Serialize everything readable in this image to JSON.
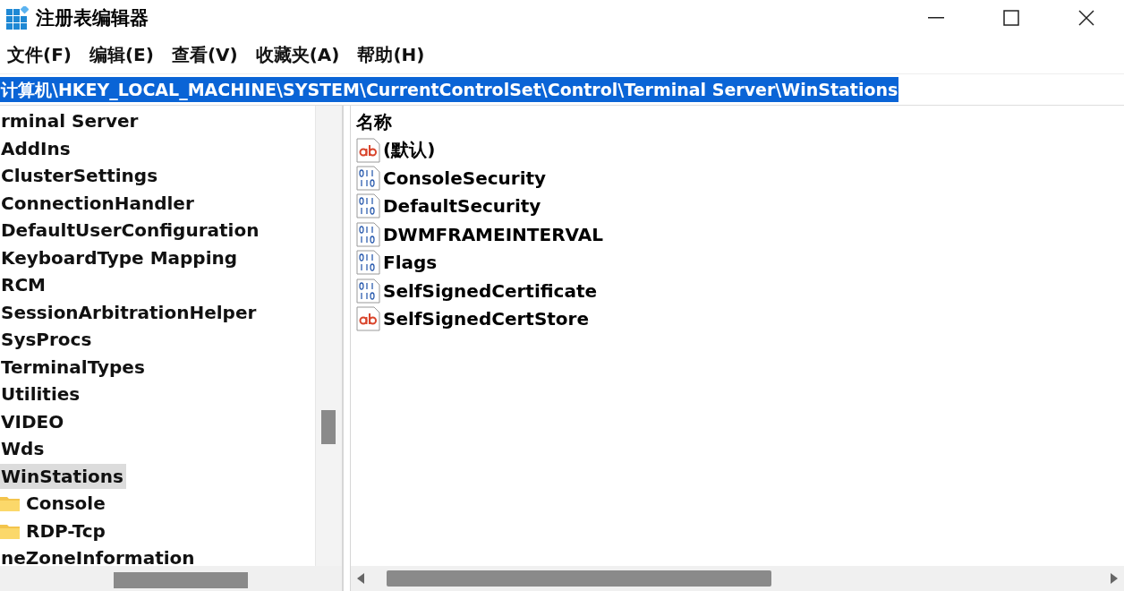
{
  "window": {
    "title": "注册表编辑器"
  },
  "menu": [
    "文件(F)",
    "编辑(E)",
    "查看(V)",
    "收藏夹(A)",
    "帮助(H)"
  ],
  "address": {
    "value": "计算机\\HKEY_LOCAL_MACHINE\\SYSTEM\\CurrentControlSet\\Control\\Terminal Server\\WinStations",
    "selected": true
  },
  "tree": [
    {
      "label": "rminal Server",
      "selected": false,
      "children": [
        {
          "label": "AddIns",
          "selected": false
        },
        {
          "label": "ClusterSettings",
          "selected": false
        },
        {
          "label": "ConnectionHandler",
          "selected": false
        },
        {
          "label": "DefaultUserConfiguration",
          "selected": false
        },
        {
          "label": "KeyboardType Mapping",
          "selected": false
        },
        {
          "label": "RCM",
          "selected": false
        },
        {
          "label": "SessionArbitrationHelper",
          "selected": false
        },
        {
          "label": "SysProcs",
          "selected": false
        },
        {
          "label": "TerminalTypes",
          "selected": false
        },
        {
          "label": "Utilities",
          "selected": false
        },
        {
          "label": "VIDEO",
          "selected": false
        },
        {
          "label": "Wds",
          "selected": false
        },
        {
          "label": "WinStations",
          "selected": true,
          "children": [
            {
              "label": "Console",
              "selected": false
            },
            {
              "label": "RDP-Tcp",
              "selected": false
            }
          ]
        }
      ]
    },
    {
      "label": "neZoneInformation",
      "selected": false
    }
  ],
  "values": {
    "column_header": "名称",
    "rows": [
      {
        "name": "(默认)",
        "kind": "string"
      },
      {
        "name": "ConsoleSecurity",
        "kind": "binary"
      },
      {
        "name": "DefaultSecurity",
        "kind": "binary"
      },
      {
        "name": "DWMFRAMEINTERVAL",
        "kind": "binary"
      },
      {
        "name": "Flags",
        "kind": "binary"
      },
      {
        "name": "SelfSignedCertificate",
        "kind": "binary"
      },
      {
        "name": "SelfSignedCertStore",
        "kind": "string"
      }
    ]
  }
}
